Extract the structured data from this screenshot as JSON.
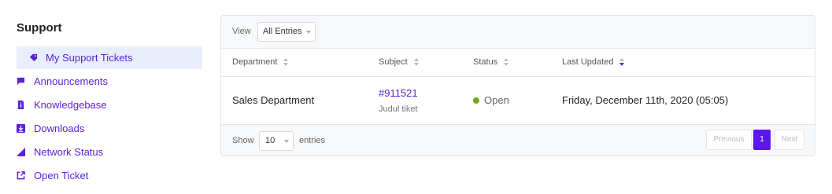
{
  "sidebar": {
    "title": "Support",
    "items": [
      {
        "label": "My Support Tickets",
        "icon": "tag-icon",
        "active": true
      },
      {
        "label": "Announcements",
        "icon": "comment-icon",
        "active": false
      },
      {
        "label": "Knowledgebase",
        "icon": "info-file-icon",
        "active": false
      },
      {
        "label": "Downloads",
        "icon": "download-icon",
        "active": false
      },
      {
        "label": "Network Status",
        "icon": "signal-icon",
        "active": false
      },
      {
        "label": "Open Ticket",
        "icon": "external-link-icon",
        "active": false
      }
    ]
  },
  "filter": {
    "view_label": "View",
    "view_value": "All Entries"
  },
  "table": {
    "headers": [
      "Department",
      "Subject",
      "Status",
      "Last Updated"
    ],
    "rows": [
      {
        "department": "Sales Department",
        "ticket_id": "#911521",
        "subject": "Judul tiket",
        "status": "Open",
        "last_updated": "Friday, December 11th, 2020 (05:05)"
      }
    ]
  },
  "footer": {
    "show_label": "Show",
    "page_length": "10",
    "entries_label": "entries",
    "prev_label": "Previous",
    "current_page": "1",
    "next_label": "Next"
  },
  "colors": {
    "accent": "#5b21d6",
    "status_open": "#6aaa16",
    "active_bg": "#e8eefc"
  }
}
